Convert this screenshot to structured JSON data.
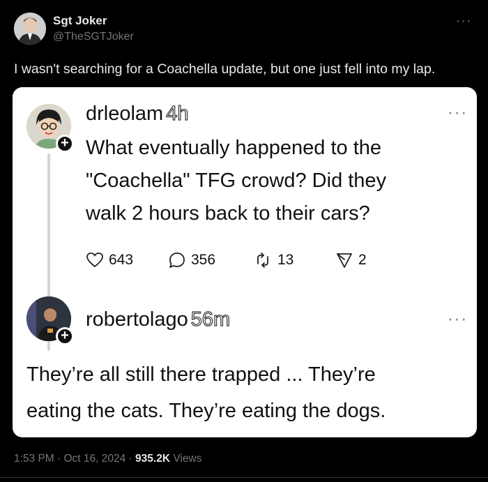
{
  "author": {
    "name": "Sgt Joker",
    "handle": "@TheSGTJoker",
    "avatar_icon": "profile-photo"
  },
  "post": {
    "text": "I wasn't searching for a Coachella update, but one just fell into my lap.",
    "timestamp": "1:53 PM · Oct 16, 2024 · ",
    "views_count": "935.2K",
    "views_label": " Views"
  },
  "embedded": {
    "first": {
      "username": "drleolam",
      "time_ago": "4h",
      "lines": [
        "What eventually happened to the",
        "\"Coachella\" TFG crowd? Did they",
        "walk 2 hours back to their cars?"
      ],
      "stats": {
        "likes": "643",
        "replies": "356",
        "reposts": "13",
        "shares": "2"
      }
    },
    "second": {
      "username": "robertolago",
      "time_ago": "56m",
      "lines": [
        "They’re all still there trapped ... They’re",
        "eating the cats. They’re eating the dogs."
      ]
    }
  },
  "colors": {
    "background": "#000000",
    "card": "#ffffff",
    "muted": "#71767b"
  }
}
